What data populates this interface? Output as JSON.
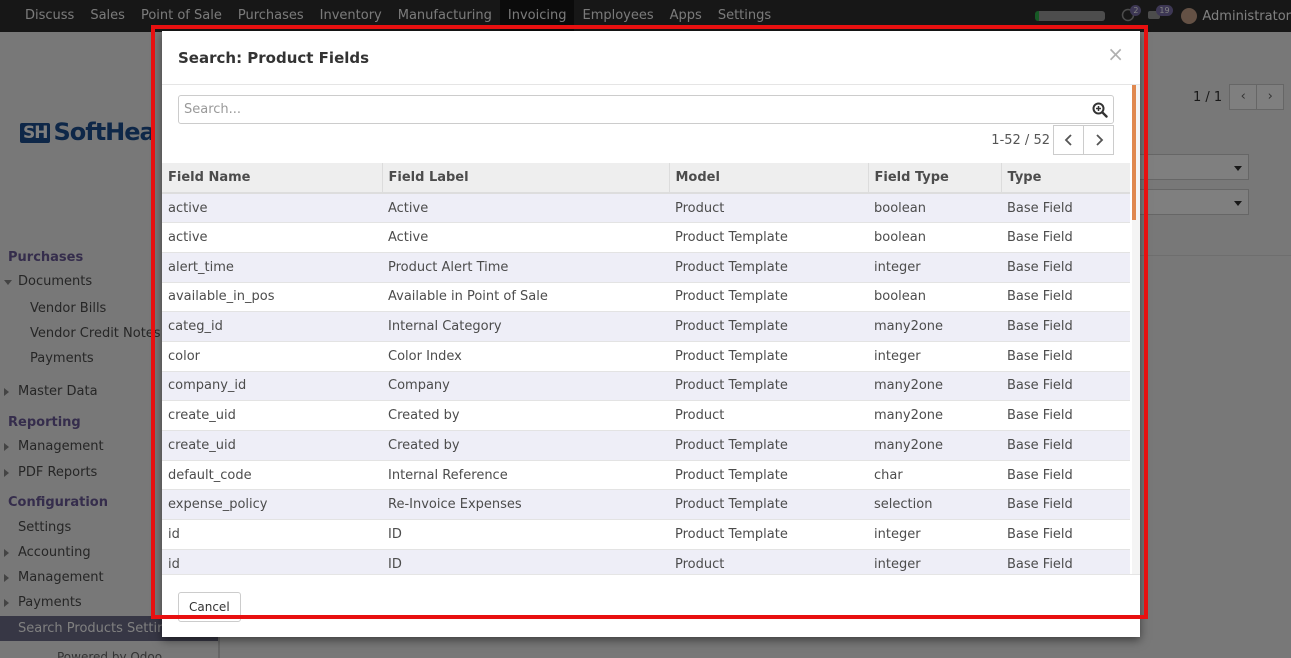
{
  "topbar": {
    "menu": [
      "Discuss",
      "Sales",
      "Point of Sale",
      "Purchases",
      "Inventory",
      "Manufacturing",
      "Invoicing",
      "Employees",
      "Apps",
      "Settings"
    ],
    "active_menu": "Invoicing",
    "messages_count": "2",
    "activities_count": "19",
    "user": "Administrator"
  },
  "background": {
    "logo_text": "SoftHea",
    "logo_mark": "SH",
    "pager": "1 / 1",
    "sidebar": {
      "purchases": "Purchases",
      "documents": "Documents",
      "vendor_bills": "Vendor Bills",
      "vendor_credit_notes": "Vendor Credit Notes",
      "payments": "Payments",
      "master_data": "Master Data",
      "reporting": "Reporting",
      "management": "Management",
      "pdf_reports": "PDF Reports",
      "configuration": "Configuration",
      "settings": "Settings",
      "accounting": "Accounting",
      "management2": "Management",
      "payments2": "Payments",
      "search_products_settings": "Search Products Setting"
    },
    "powered_by": "Powered by Odoo"
  },
  "dialog": {
    "title": "Search: Product Fields",
    "close_symbol": "×",
    "search_placeholder": "Search...",
    "pager_value": "1-52 / 52",
    "columns": [
      "Field Name",
      "Field Label",
      "Model",
      "Field Type",
      "Type"
    ],
    "rows": [
      [
        "active",
        "Active",
        "Product",
        "boolean",
        "Base Field"
      ],
      [
        "active",
        "Active",
        "Product Template",
        "boolean",
        "Base Field"
      ],
      [
        "alert_time",
        "Product Alert Time",
        "Product Template",
        "integer",
        "Base Field"
      ],
      [
        "available_in_pos",
        "Available in Point of Sale",
        "Product Template",
        "boolean",
        "Base Field"
      ],
      [
        "categ_id",
        "Internal Category",
        "Product Template",
        "many2one",
        "Base Field"
      ],
      [
        "color",
        "Color Index",
        "Product Template",
        "integer",
        "Base Field"
      ],
      [
        "company_id",
        "Company",
        "Product Template",
        "many2one",
        "Base Field"
      ],
      [
        "create_uid",
        "Created by",
        "Product",
        "many2one",
        "Base Field"
      ],
      [
        "create_uid",
        "Created by",
        "Product Template",
        "many2one",
        "Base Field"
      ],
      [
        "default_code",
        "Internal Reference",
        "Product Template",
        "char",
        "Base Field"
      ],
      [
        "expense_policy",
        "Re-Invoice Expenses",
        "Product Template",
        "selection",
        "Base Field"
      ],
      [
        "id",
        "ID",
        "Product Template",
        "integer",
        "Base Field"
      ],
      [
        "id",
        "ID",
        "Product",
        "integer",
        "Base Field"
      ]
    ],
    "cancel_label": "Cancel"
  },
  "colors": {
    "highlight": "#e81010",
    "odd_row": "#eeeef7",
    "sidebar_section": "#6b5a98",
    "scroll_thumb": "#e0884f"
  }
}
